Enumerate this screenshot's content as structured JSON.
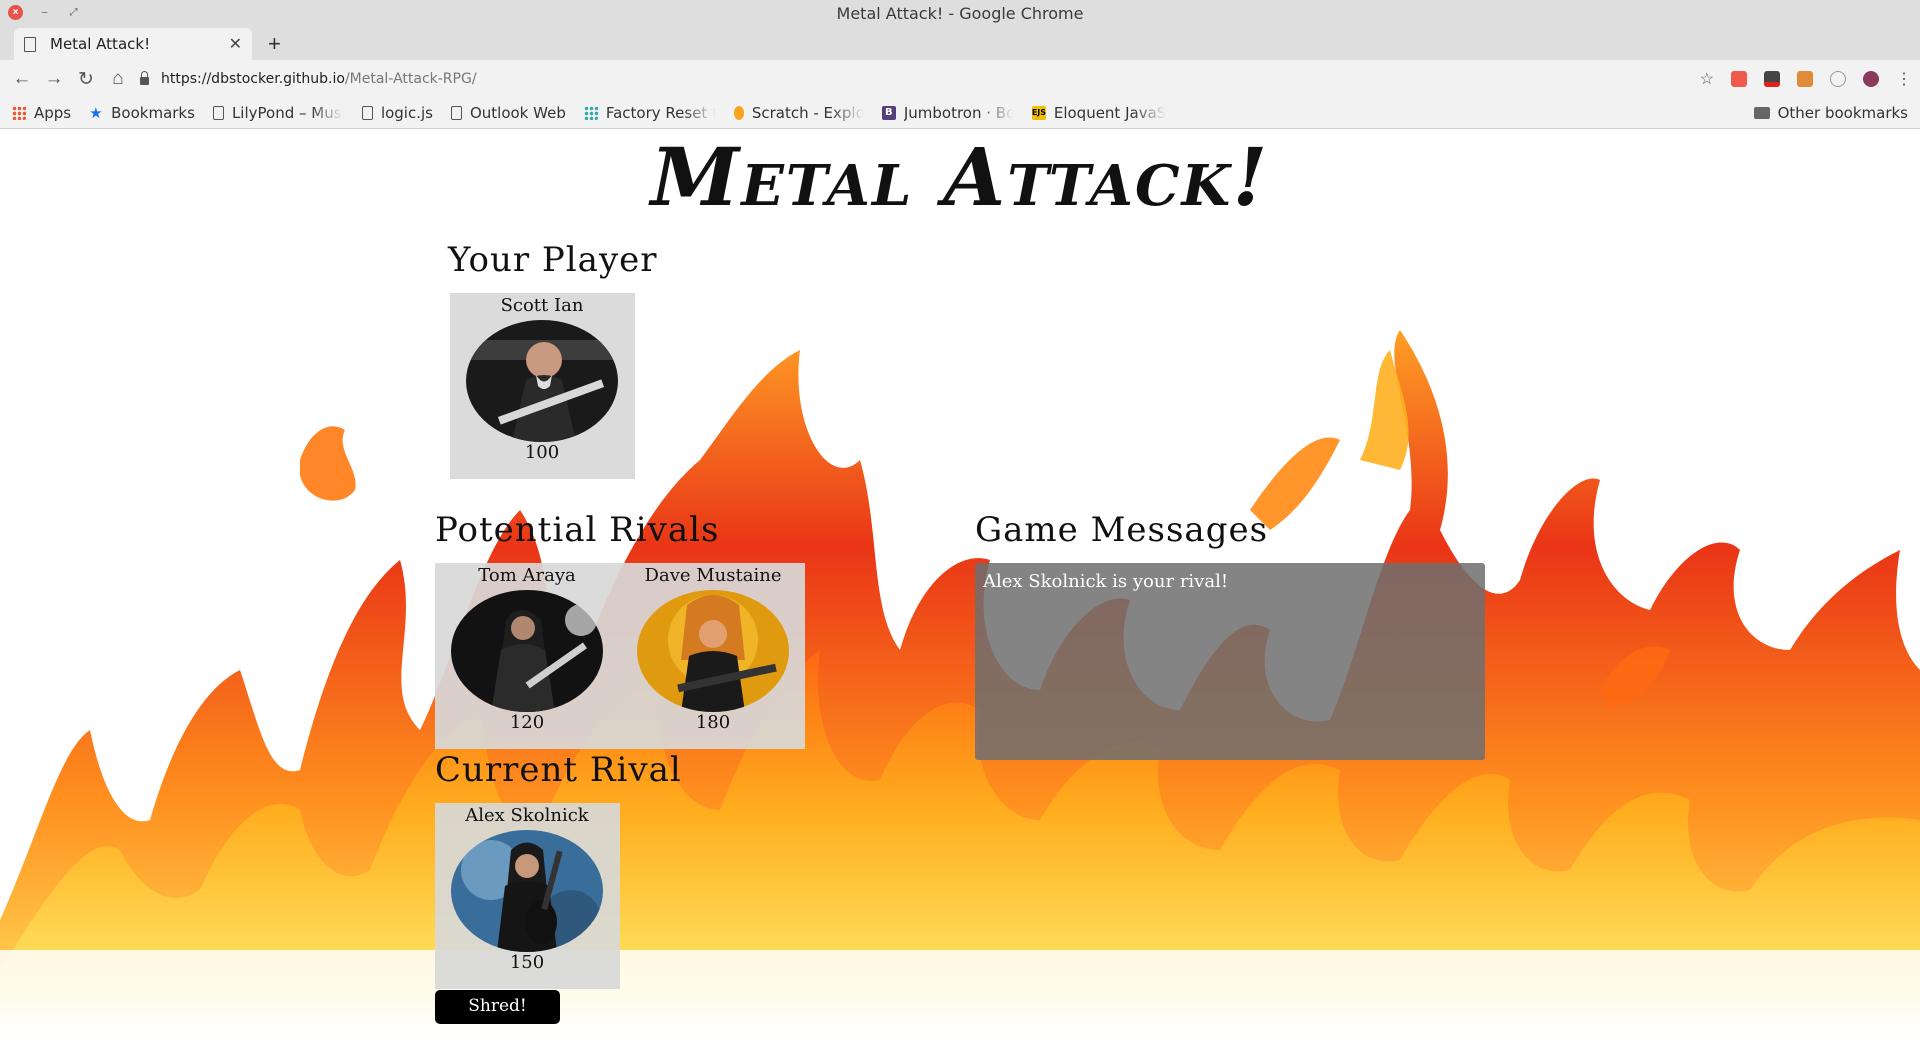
{
  "window": {
    "title": "Metal Attack! - Google Chrome"
  },
  "tab": {
    "label": "Metal Attack!"
  },
  "address": {
    "host": "https://dbstocker.github.io",
    "path": "/Metal-Attack-RPG/"
  },
  "bookmarks": {
    "items": [
      {
        "label": "Apps",
        "icon": "apps-grid-icon"
      },
      {
        "label": "Bookmarks",
        "icon": "star-icon"
      },
      {
        "label": "LilyPond – Musi",
        "icon": "page-icon"
      },
      {
        "label": "logic.js",
        "icon": "page-icon"
      },
      {
        "label": "Outlook Web",
        "icon": "page-icon"
      },
      {
        "label": "Factory Reset f",
        "icon": "dots-icon"
      },
      {
        "label": "Scratch - Explor",
        "icon": "scratch-icon"
      },
      {
        "label": "Jumbotron · Bo",
        "icon": "bootstrap-icon"
      },
      {
        "label": "Eloquent JavaS",
        "icon": "ejs-icon"
      }
    ],
    "other": "Other bookmarks"
  },
  "game": {
    "title": "Metal Attack!",
    "your_player_heading": "Your Player",
    "rivals_heading": "Potential Rivals",
    "current_rival_heading": "Current Rival",
    "messages_heading": "Game Messages",
    "message": "Alex Skolnick is your rival!",
    "shred_label": "Shred!",
    "player": {
      "name": "Scott Ian",
      "hp": "100"
    },
    "rivals": [
      {
        "name": "Tom Araya",
        "hp": "120"
      },
      {
        "name": "Dave Mustaine",
        "hp": "180"
      }
    ],
    "current_rival": {
      "name": "Alex Skolnick",
      "hp": "150"
    }
  },
  "colors": {
    "flame_outer": "#ff9a1a",
    "flame_inner": "#e8200a",
    "flame_core": "#ffe14d",
    "message_box": "#6e6e6e",
    "card_bg": "#d8d8d8"
  }
}
